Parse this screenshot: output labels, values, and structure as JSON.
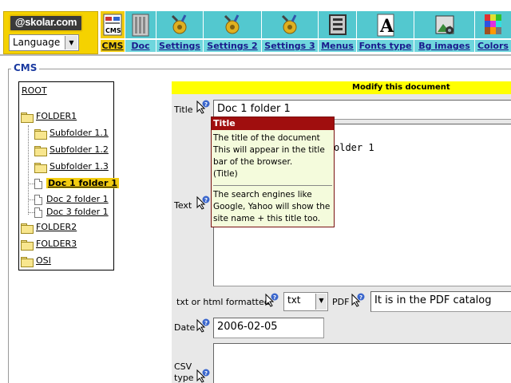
{
  "header": {
    "logo_text": "@skolar.com",
    "language_select": "Language",
    "menu": [
      {
        "label": "CMS",
        "icon": "cms-icon",
        "active": true
      },
      {
        "label": "Doc",
        "icon": "doc-icon"
      },
      {
        "label": "Settings",
        "icon": "settings-icon"
      },
      {
        "label": "Settings 2",
        "icon": "settings-2-icon"
      },
      {
        "label": "Settings 3",
        "icon": "settings-3-icon"
      },
      {
        "label": "Menus",
        "icon": "menus-icon"
      },
      {
        "label": "Fonts type",
        "icon": "fonts-type-icon"
      },
      {
        "label": "Bg images",
        "icon": "bg-images-icon"
      },
      {
        "label": "Colors",
        "icon": "colors-icon"
      }
    ]
  },
  "section_title": "CMS",
  "tree": {
    "root": "ROOT",
    "items": [
      {
        "label": "FOLDER1",
        "type": "folder"
      },
      {
        "label": "Subfolder 1.1",
        "type": "folder"
      },
      {
        "label": "Subfolder 1.2",
        "type": "folder"
      },
      {
        "label": "Subfolder 1.3",
        "type": "folder"
      },
      {
        "label": "Doc 1 folder 1",
        "type": "doc",
        "selected": true
      },
      {
        "label": "Doc 2 folder 1",
        "type": "doc"
      },
      {
        "label": "Doc 3 folder 1",
        "type": "doc"
      },
      {
        "label": "FOLDER2",
        "type": "folder"
      },
      {
        "label": "FOLDER3",
        "type": "folder"
      },
      {
        "label": "OSI",
        "type": "folder"
      }
    ]
  },
  "form": {
    "heading": "Modify this document",
    "title_label": "Title",
    "title_value": "Doc 1 folder 1",
    "text_label": "Text",
    "text_value_visible": "older 1",
    "format_label": "txt or html formatted",
    "format_value": "txt",
    "pdf_label": "PDF",
    "pdf_value": "It is in the PDF catalog",
    "date_label": "Date",
    "date_value": "2006-02-05",
    "csv_label_line1": "CSV",
    "csv_label_line2": "type"
  },
  "tooltip": {
    "title": "Title",
    "line1": "The title of the document",
    "line2": "This will appear in the title",
    "line3": "bar of the browser.",
    "line4": "(Title)",
    "line5": "The search engines like",
    "line6": "Google, Yahoo will show the",
    "line7": "site name + this title too."
  },
  "colors": {
    "toolbar_teal": "#53c8cf",
    "active_yellow": "#f2cc10",
    "heading_yellow": "#ffff00",
    "tooltip_title_red": "#a00e0e",
    "tooltip_bg": "#f4fbdc"
  }
}
